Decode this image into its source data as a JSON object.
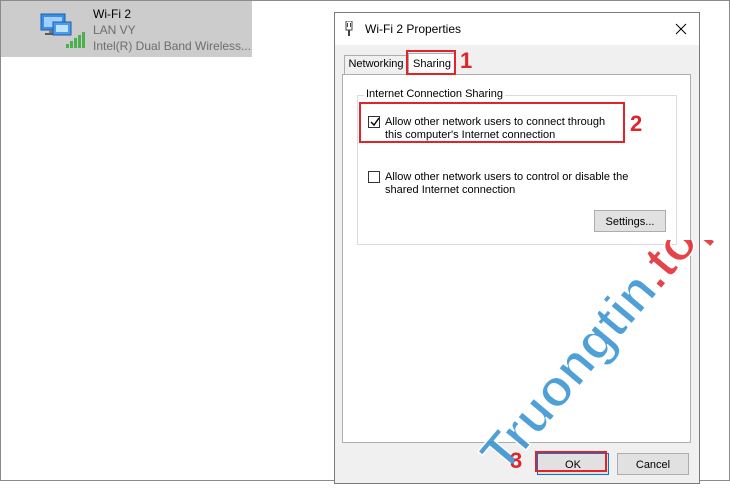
{
  "adapter": {
    "name": "Wi-Fi 2",
    "network": "LAN VY",
    "device": "Intel(R) Dual Band Wireless..."
  },
  "dialog": {
    "title": "Wi-Fi 2 Properties",
    "tabs": [
      {
        "label": "Networking",
        "selected": false
      },
      {
        "label": "Sharing",
        "selected": true
      }
    ],
    "group_title": "Internet Connection Sharing",
    "options": [
      {
        "label": "Allow other network users to connect through this computer's Internet connection",
        "checked": true
      },
      {
        "label": "Allow other network users to control or disable the shared Internet connection",
        "checked": false
      }
    ],
    "settings_button": "Settings...",
    "ok_button": "OK",
    "cancel_button": "Cancel"
  },
  "annotations": {
    "step_1": "1",
    "step_2": "2",
    "step_3": "3",
    "color": "#e0242a"
  },
  "watermark": {
    "text_part1": "Truongtin",
    "text_part2": ".top"
  },
  "colors": {
    "accent": "#0078d7",
    "tile_bg": "#cccccc",
    "signal_green": "#4caf50"
  }
}
